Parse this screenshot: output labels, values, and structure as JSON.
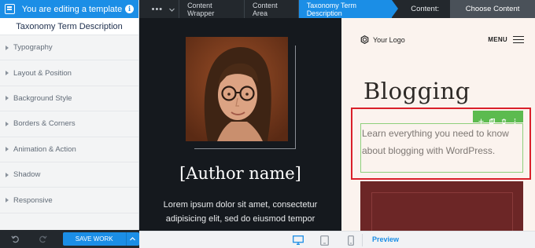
{
  "left_panel": {
    "header_title": "You are editing a template",
    "subtitle": "Taxonomy Term Description",
    "sections": [
      "Typography",
      "Layout & Position",
      "Background Style",
      "Borders & Corners",
      "Animation & Action",
      "Shadow",
      "Responsive"
    ],
    "save_label": "SAVE WORK"
  },
  "topbar": {
    "dots": "•••",
    "breadcrumbs": [
      "Content Wrapper",
      "Content Area",
      "Taxonomy Term Description"
    ],
    "content_label": "Content:",
    "choose_label": "Choose Content"
  },
  "canvas": {
    "author_name": "[Author name]",
    "lorem": "Lorem ipsum dolor sit amet, consectetur adipisicing elit, sed do eiusmod tempor"
  },
  "preview_site": {
    "logo_text": "Your Logo",
    "menu_label": "MENU",
    "title": "Blogging",
    "description": "Learn everything you need to know about blogging with WordPress."
  },
  "bottombar": {
    "preview_label": "Preview"
  },
  "colors": {
    "accent": "#1b8ee6",
    "dark_bar": "#23282d",
    "selection_red": "#d9202a",
    "selection_green": "#5cbb4f",
    "maroon": "#6c2626"
  }
}
